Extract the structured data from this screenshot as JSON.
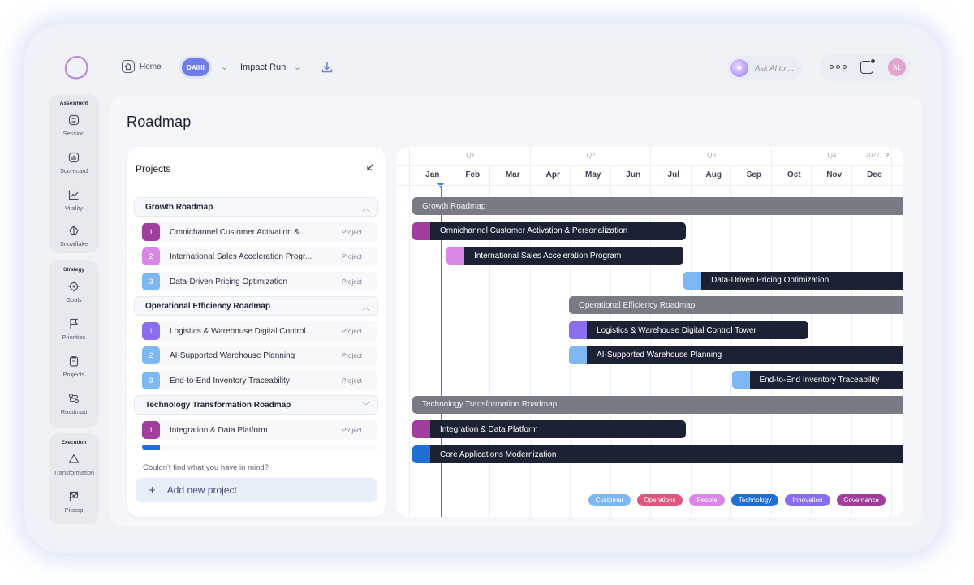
{
  "topbar": {
    "home_label": "Home",
    "workspace_badge": "DAIHI",
    "run_label": "Impact Run",
    "ask_ai_placeholder": "Ask AI to ...",
    "avatar_initials": "AL"
  },
  "sidebar": {
    "groups": [
      {
        "title": "Assesment",
        "items": [
          {
            "label": "Session",
            "icon": "session-icon"
          },
          {
            "label": "Scorecard",
            "icon": "scorecard-icon"
          },
          {
            "label": "Vitality",
            "icon": "vitality-icon"
          },
          {
            "label": "Snowflake",
            "icon": "snowflake-icon"
          }
        ]
      },
      {
        "title": "Strategy",
        "items": [
          {
            "label": "Goals",
            "icon": "goals-icon"
          },
          {
            "label": "Priorities",
            "icon": "flag-icon"
          },
          {
            "label": "Projects",
            "icon": "clipboard-icon"
          },
          {
            "label": "Roadmap",
            "icon": "roadmap-icon"
          }
        ]
      },
      {
        "title": "Execution",
        "items": [
          {
            "label": "Transformation",
            "icon": "recycle-icon"
          },
          {
            "label": "Pitstop",
            "icon": "checkered-flag-icon"
          }
        ]
      }
    ]
  },
  "page": {
    "title": "Roadmap"
  },
  "projects": {
    "header": "Projects",
    "groups": [
      {
        "name": "Growth Roadmap",
        "items": [
          {
            "num": "1",
            "name": "Omnichannel Customer Activation &...",
            "tag": "Project",
            "color": "#a13e9c"
          },
          {
            "num": "2",
            "name": "International Sales Acceleration Progr...",
            "tag": "Project",
            "color": "#d986e6"
          },
          {
            "num": "3",
            "name": "Data-Driven Pricing Optimization",
            "tag": "Project",
            "color": "#7eb8f2"
          }
        ]
      },
      {
        "name": "Operational Efficiency Roadmap",
        "items": [
          {
            "num": "1",
            "name": "Logistics & Warehouse Digital Control...",
            "tag": "Project",
            "color": "#8b6ef0"
          },
          {
            "num": "2",
            "name": "AI-Supported Warehouse Planning",
            "tag": "Project",
            "color": "#7eb8f2"
          },
          {
            "num": "3",
            "name": "End-to-End Inventory Traceability",
            "tag": "Project",
            "color": "#7eb8f2"
          }
        ]
      },
      {
        "name": "Technology Transformation Roadmap",
        "items": [
          {
            "num": "1",
            "name": "Integration & Data Platform",
            "tag": "Project",
            "color": "#a13e9c"
          }
        ]
      }
    ],
    "hint": "Couldn't find what you have in mind?",
    "add_label": "Add new project"
  },
  "timeline": {
    "quarters": [
      "Q1",
      "Q2",
      "Q3",
      "Q4"
    ],
    "year_label": "2027",
    "months": [
      "Jan",
      "Feb",
      "Mar",
      "Apr",
      "May",
      "Jun",
      "Jul",
      "Aug",
      "Sep",
      "Oct",
      "Nov",
      "Dec"
    ],
    "rows": [
      {
        "label": "Growth Roadmap",
        "kind": "group",
        "start_month": 0.0,
        "end_month": 12.0
      },
      {
        "label": "Omnichannel Customer Activation & Personalization",
        "kind": "project",
        "start_month": 0.0,
        "end_month": 6.8,
        "color": "#a13e9c"
      },
      {
        "label": "International Sales Acceleration Program",
        "kind": "project",
        "start_month": 0.85,
        "end_month": 6.75,
        "color": "#d986e6"
      },
      {
        "label": "Data-Driven Pricing Optimization",
        "kind": "project",
        "start_month": 6.75,
        "end_month": 12.0,
        "color": "#7eb8f2"
      },
      {
        "label": "Operational Efficiency Roadmap",
        "kind": "group",
        "start_month": 3.9,
        "end_month": 12.0
      },
      {
        "label": "Logistics & Warehouse Digital Control Tower",
        "kind": "project",
        "start_month": 3.9,
        "end_month": 9.85,
        "color": "#8b6ef0"
      },
      {
        "label": "AI-Supported Warehouse Planning",
        "kind": "project",
        "start_month": 3.9,
        "end_month": 12.0,
        "color": "#7eb8f2"
      },
      {
        "label": "End-to-End Inventory Traceability",
        "kind": "project",
        "start_month": 7.95,
        "end_month": 12.0,
        "color": "#7eb8f2"
      },
      {
        "label": "Technology Transformation Roadmap",
        "kind": "group",
        "start_month": 0.0,
        "end_month": 12.0
      },
      {
        "label": "Integration & Data Platform",
        "kind": "project",
        "start_month": 0.0,
        "end_month": 6.8,
        "color": "#a13e9c"
      },
      {
        "label": "Core Applications Modernization",
        "kind": "project",
        "start_month": 0.0,
        "end_month": 12.0,
        "color": "#1f6fd6"
      }
    ],
    "legend": [
      {
        "label": "Customer",
        "color": "#7eb8f2"
      },
      {
        "label": "Operations",
        "color": "#e0577e"
      },
      {
        "label": "People",
        "color": "#d986e6"
      },
      {
        "label": "Technology",
        "color": "#1f6fd6"
      },
      {
        "label": "Innovation",
        "color": "#8b6ef0"
      },
      {
        "label": "Governance",
        "color": "#a13e9c"
      }
    ]
  }
}
